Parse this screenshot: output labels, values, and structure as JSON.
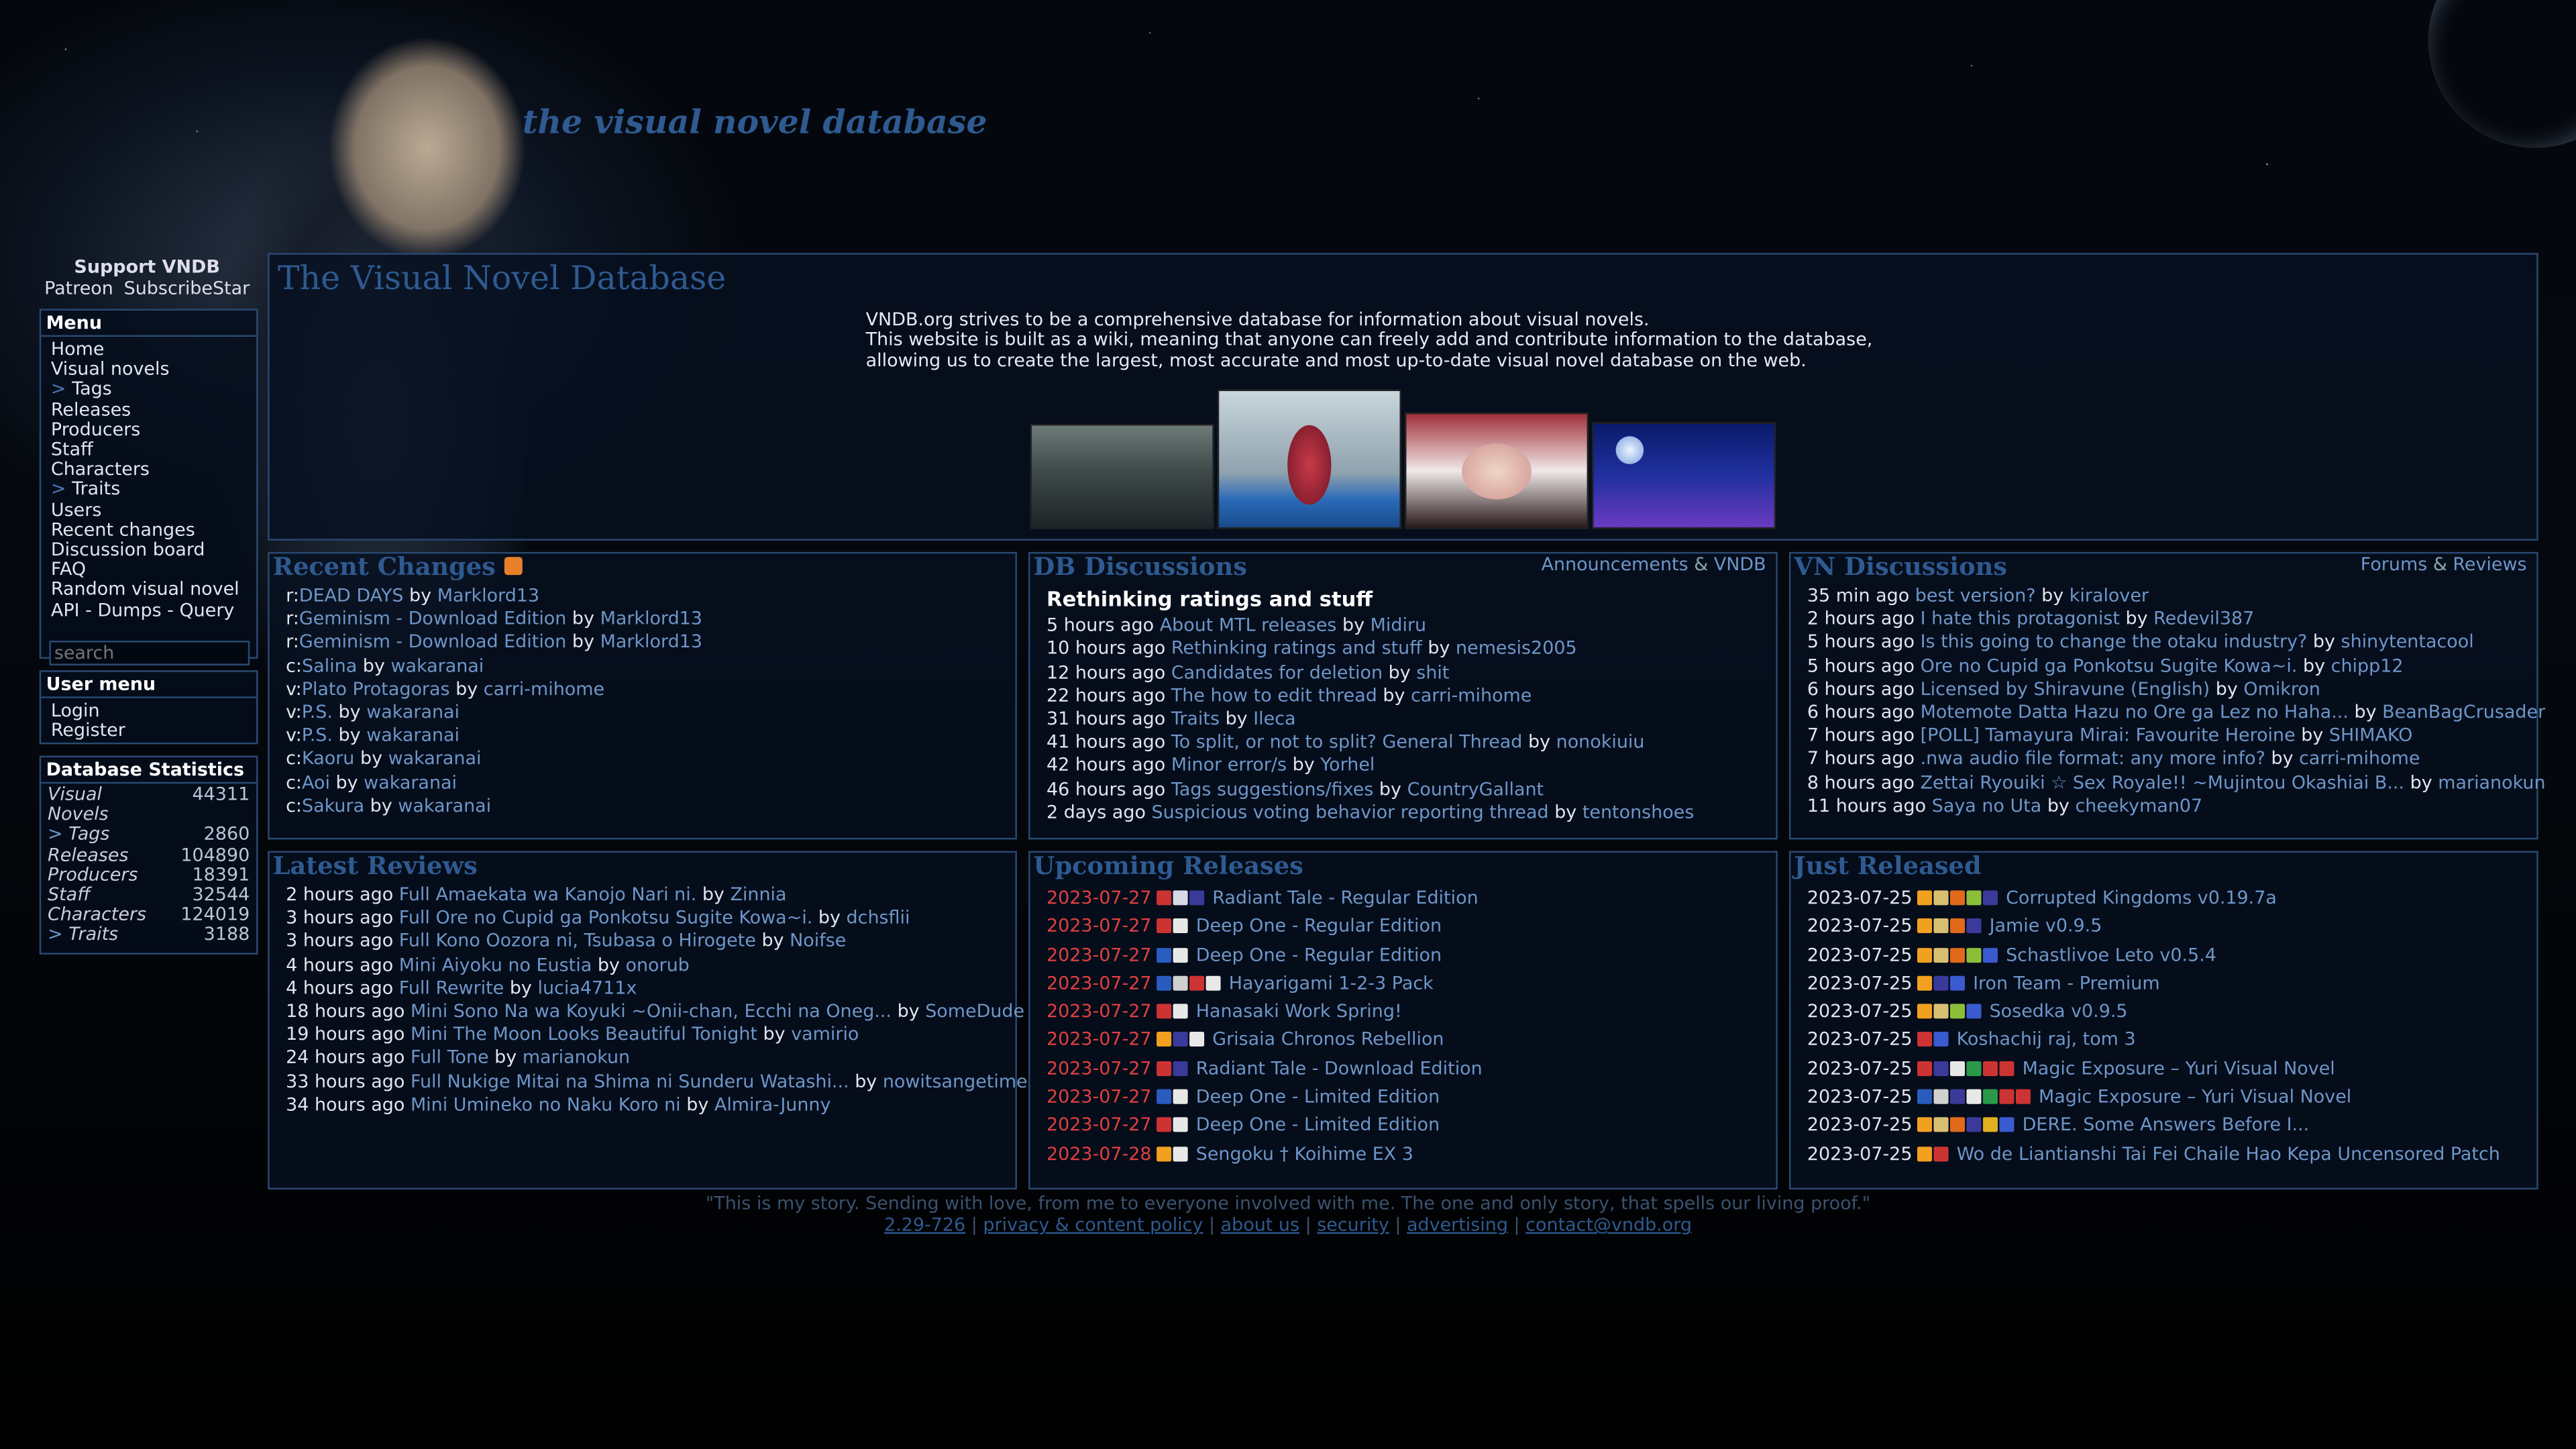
{
  "brand": {
    "logo_text": "the visual novel database"
  },
  "support": {
    "title": "Support VNDB",
    "links": [
      "Patreon",
      "SubscribeStar"
    ]
  },
  "menu": {
    "title": "Menu",
    "items": [
      "Home",
      "Visual novels",
      "Tags",
      "Releases",
      "Producers",
      "Staff",
      "Characters",
      "Traits",
      "Users",
      "Recent changes",
      "Discussion board",
      "FAQ",
      "Random visual novel"
    ],
    "api_links": [
      "API",
      "Dumps",
      "Query"
    ],
    "search_placeholder": "search"
  },
  "user_menu": {
    "title": "User menu",
    "items": [
      "Login",
      "Register"
    ]
  },
  "stats": {
    "title": "Database Statistics",
    "rows": [
      {
        "label": "Visual Novels",
        "value": "44311"
      },
      {
        "label": "Tags",
        "value": "2860"
      },
      {
        "label": "Releases",
        "value": "104890"
      },
      {
        "label": "Producers",
        "value": "18391"
      },
      {
        "label": "Staff",
        "value": "32544"
      },
      {
        "label": "Characters",
        "value": "124019"
      },
      {
        "label": "Traits",
        "value": "3188"
      }
    ]
  },
  "main": {
    "title": "The Visual Novel Database",
    "intro_1": "VNDB.org strives to be a comprehensive database for information about visual novels.",
    "intro_2": "This website is built as a wiki, meaning that anyone can freely add and contribute information to the database, allowing us to create the largest, most accurate and most up-to-date visual novel database on the web."
  },
  "recent_changes": {
    "title": "Recent Changes",
    "items": [
      {
        "prefix": "r:",
        "title": "DEAD DAYS",
        "by": "Marklord13"
      },
      {
        "prefix": "r:",
        "title": "Geminism - Download Edition",
        "by": "Marklord13"
      },
      {
        "prefix": "r:",
        "title": "Geminism - Download Edition",
        "by": "Marklord13"
      },
      {
        "prefix": "c:",
        "title": "Salina",
        "by": "wakaranai"
      },
      {
        "prefix": "v:",
        "title": "Plato Protagoras",
        "by": "carri-mihome"
      },
      {
        "prefix": "v:",
        "title": "P.S.",
        "by": "wakaranai"
      },
      {
        "prefix": "v:",
        "title": "P.S.",
        "by": "wakaranai"
      },
      {
        "prefix": "c:",
        "title": "Kaoru",
        "by": "wakaranai"
      },
      {
        "prefix": "c:",
        "title": "Aoi",
        "by": "wakaranai"
      },
      {
        "prefix": "c:",
        "title": "Sakura",
        "by": "wakaranai"
      }
    ]
  },
  "db_discussions": {
    "title": "DB Discussions",
    "links": [
      "Announcements",
      "VNDB"
    ],
    "headline": "Rethinking ratings and stuff",
    "items": [
      {
        "time": "5 hours ago",
        "title": "About MTL releases",
        "by": "Midiru"
      },
      {
        "time": "10 hours ago",
        "title": "Rethinking ratings and stuff",
        "by": "nemesis2005"
      },
      {
        "time": "12 hours ago",
        "title": "Candidates for deletion",
        "by": "shit"
      },
      {
        "time": "22 hours ago",
        "title": "The how to edit thread",
        "by": "carri-mihome"
      },
      {
        "time": "31 hours ago",
        "title": "Traits",
        "by": "Ileca"
      },
      {
        "time": "41 hours ago",
        "title": "To split, or not to split? General Thread",
        "by": "nonokiuiu"
      },
      {
        "time": "42 hours ago",
        "title": "Minor error/s",
        "by": "Yorhel"
      },
      {
        "time": "46 hours ago",
        "title": "Tags suggestions/fixes",
        "by": "CountryGallant"
      },
      {
        "time": "2 days ago",
        "title": "Suspicious voting behavior reporting thread",
        "by": "tentonshoes"
      }
    ]
  },
  "vn_discussions": {
    "title": "VN Discussions",
    "links": [
      "Forums",
      "Reviews"
    ],
    "items": [
      {
        "time": "35 min ago",
        "title": "best version?",
        "by": "kiralover"
      },
      {
        "time": "2 hours ago",
        "title": "I hate this protagonist",
        "by": "Redevil387"
      },
      {
        "time": "5 hours ago",
        "title": "Is this going to change the otaku industry?",
        "by": "shinytentacool"
      },
      {
        "time": "5 hours ago",
        "title": "Ore no Cupid ga Ponkotsu Sugite Kowa~i.",
        "by": "chipp12"
      },
      {
        "time": "6 hours ago",
        "title": "Licensed by Shiravune (English)",
        "by": "Omikron"
      },
      {
        "time": "6 hours ago",
        "title": "Motemote Datta Hazu no Ore ga Lez no Haha...",
        "by": "BeanBagCrusader"
      },
      {
        "time": "7 hours ago",
        "title": "[POLL] Tamayura Mirai: Favourite Heroine",
        "by": "SHIMAKO"
      },
      {
        "time": "7 hours ago",
        "title": ".nwa audio file format: any more info?",
        "by": "carri-mihome"
      },
      {
        "time": "8 hours ago",
        "title": "Zettai Ryouiki ☆ Sex Royale!! ~Mujintou Okashiai B...",
        "by": "marianokun"
      },
      {
        "time": "11 hours ago",
        "title": "Saya no Uta",
        "by": "cheekyman07"
      }
    ]
  },
  "latest_reviews": {
    "title": "Latest Reviews",
    "items": [
      {
        "time": "2 hours ago",
        "type": "Full",
        "title": "Amaekata wa Kanojo Nari ni.",
        "by": "Zinnia"
      },
      {
        "time": "3 hours ago",
        "type": "Full",
        "title": "Ore no Cupid ga Ponkotsu Sugite Kowa~i.",
        "by": "dchsflii"
      },
      {
        "time": "3 hours ago",
        "type": "Full",
        "title": "Kono Oozora ni, Tsubasa o Hirogete",
        "by": "Noifse"
      },
      {
        "time": "4 hours ago",
        "type": "Mini",
        "title": "Aiyoku no Eustia",
        "by": "onorub"
      },
      {
        "time": "4 hours ago",
        "type": "Full",
        "title": "Rewrite",
        "by": "lucia4711x"
      },
      {
        "time": "18 hours ago",
        "type": "Mini",
        "title": "Sono Na wa Koyuki ~Onii-chan, Ecchi na Oneg...",
        "by": "SomeDude"
      },
      {
        "time": "19 hours ago",
        "type": "Mini",
        "title": "The Moon Looks Beautiful Tonight",
        "by": "vamirio"
      },
      {
        "time": "24 hours ago",
        "type": "Full",
        "title": "Tone",
        "by": "marianokun"
      },
      {
        "time": "33 hours ago",
        "type": "Full",
        "title": "Nukige Mitai na Shima ni Sunderu Watashi...",
        "by": "nowitsangetime"
      },
      {
        "time": "34 hours ago",
        "type": "Mini",
        "title": "Umineko no Naku Koro ni",
        "by": "Almira-Junny"
      }
    ]
  },
  "upcoming_releases": {
    "title": "Upcoming Releases",
    "items": [
      {
        "date": "2023-07-27",
        "flags": [
          "#c33",
          "#d8d8e8",
          "#3a3a9a"
        ],
        "title": "Radiant Tale - Regular Edition"
      },
      {
        "date": "2023-07-27",
        "flags": [
          "#c33",
          "#e8e8e8"
        ],
        "title": "Deep One - Regular Edition"
      },
      {
        "date": "2023-07-27",
        "flags": [
          "#2a5cc0",
          "#e8e8e8"
        ],
        "title": "Deep One - Regular Edition"
      },
      {
        "date": "2023-07-27",
        "flags": [
          "#2a5cc0",
          "#d0d0d0",
          "#c33",
          "#e8e8e8"
        ],
        "title": "Hayarigami 1-2-3 Pack"
      },
      {
        "date": "2023-07-27",
        "flags": [
          "#c33",
          "#e8e8e8"
        ],
        "title": "Hanasaki Work Spring!"
      },
      {
        "date": "2023-07-27",
        "flags": [
          "#f2a020",
          "#3a3a9a",
          "#e8e8e8"
        ],
        "title": "Grisaia Chronos Rebellion"
      },
      {
        "date": "2023-07-27",
        "flags": [
          "#c33",
          "#3a3a9a"
        ],
        "title": "Radiant Tale - Download Edition"
      },
      {
        "date": "2023-07-27",
        "flags": [
          "#2a5cc0",
          "#e8e8e8"
        ],
        "title": "Deep One - Limited Edition"
      },
      {
        "date": "2023-07-27",
        "flags": [
          "#c33",
          "#e8e8e8"
        ],
        "title": "Deep One - Limited Edition"
      },
      {
        "date": "2023-07-28",
        "flags": [
          "#f2a020",
          "#e8e8e8"
        ],
        "title": "Sengoku † Koihime EX 3"
      }
    ]
  },
  "just_released": {
    "title": "Just Released",
    "items": [
      {
        "date": "2023-07-25",
        "flags": [
          "#f2a020",
          "#d8c070",
          "#e06a1a",
          "#8bbf3a",
          "#3a3a9a"
        ],
        "title": "Corrupted Kingdoms v0.19.7a"
      },
      {
        "date": "2023-07-25",
        "flags": [
          "#f2a020",
          "#d8c070",
          "#e06a1a",
          "#3a3a9a"
        ],
        "title": "Jamie v0.9.5"
      },
      {
        "date": "2023-07-25",
        "flags": [
          "#f2a020",
          "#d8c070",
          "#e06a1a",
          "#8bbf3a",
          "#3a5ad0"
        ],
        "title": "Schastlivoe Leto v0.5.4"
      },
      {
        "date": "2023-07-25",
        "flags": [
          "#f2a020",
          "#3a3a9a",
          "#3a5ad0"
        ],
        "title": "Iron Team - Premium"
      },
      {
        "date": "2023-07-25",
        "flags": [
          "#f2a020",
          "#d8c070",
          "#8bbf3a",
          "#3a5ad0"
        ],
        "title": "Sosedka v0.9.5"
      },
      {
        "date": "2023-07-25",
        "flags": [
          "#c33",
          "#3a5ad0"
        ],
        "title": "Koshachij raj, tom 3"
      },
      {
        "date": "2023-07-25",
        "flags": [
          "#c33",
          "#3a3a9a",
          "#e8e8e8",
          "#2a9a4a",
          "#c33",
          "#c33"
        ],
        "title": "Magic Exposure – Yuri Visual Novel"
      },
      {
        "date": "2023-07-25",
        "flags": [
          "#2a5cc0",
          "#d0d0d0",
          "#3a3a9a",
          "#e8e8e8",
          "#2a9a4a",
          "#c33",
          "#c33"
        ],
        "title": "Magic Exposure – Yuri Visual Novel"
      },
      {
        "date": "2023-07-25",
        "flags": [
          "#f2a020",
          "#d8c070",
          "#e06a1a",
          "#3a3a9a",
          "#e0b020",
          "#3a5ad0"
        ],
        "title": "DERE. Some Answers Before I..."
      },
      {
        "date": "2023-07-25",
        "flags": [
          "#f2a020",
          "#c33"
        ],
        "title": "Wo de Liantianshi Tai Fei Chaile Hao Kepa Uncensored Patch"
      }
    ]
  },
  "footer": {
    "quote": "\"This is my story. Sending with love, from me to everyone involved with me. The one and only story, that spells our living proof.\"",
    "links": [
      "2.29-726",
      "privacy & content policy",
      "about us",
      "security",
      "advertising",
      "contact@vndb.org"
    ]
  },
  "colors": {
    "accent": "#2e5a90",
    "link": "#6e96c8",
    "date_upcoming": "#e04040"
  }
}
